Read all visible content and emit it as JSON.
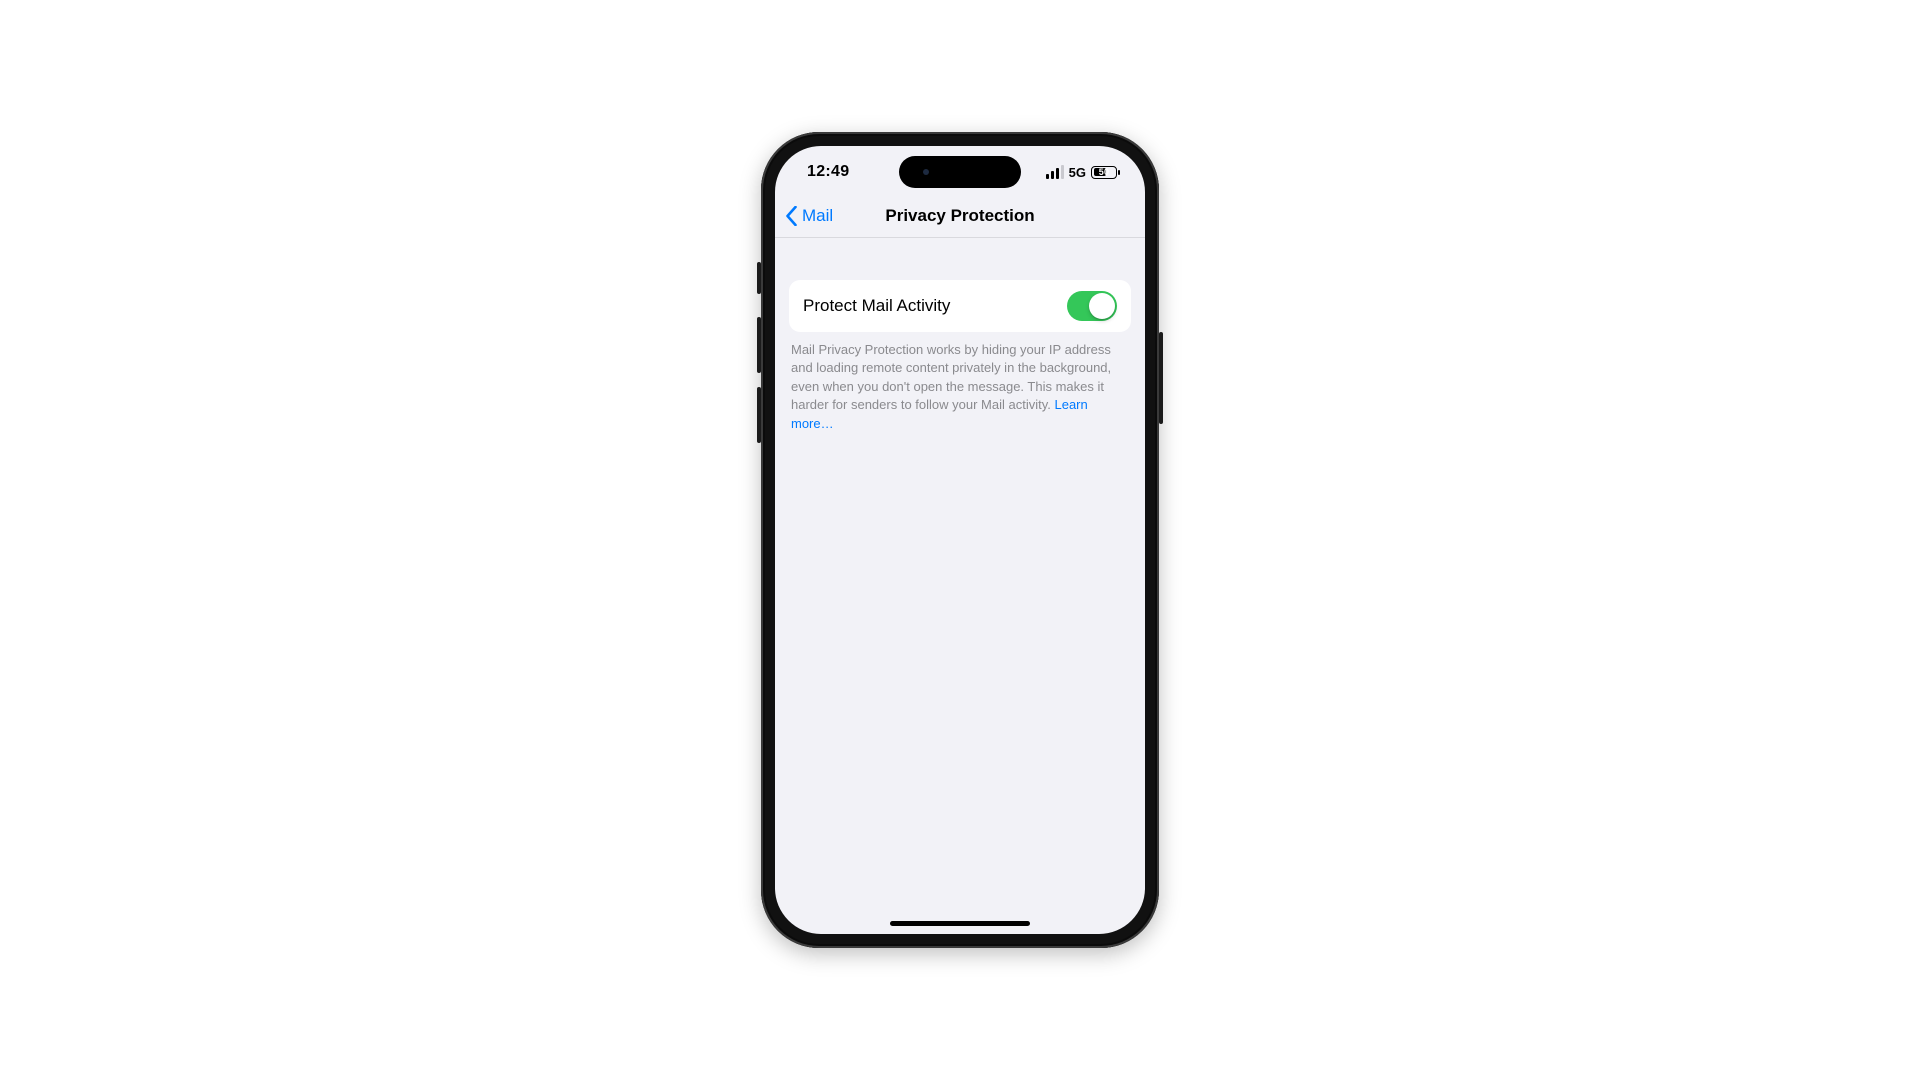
{
  "status": {
    "time": "12:49",
    "network": "5G",
    "battery_pct": "50"
  },
  "nav": {
    "back_label": "Mail",
    "title": "Privacy Protection"
  },
  "settings": {
    "protect_label": "Protect Mail Activity",
    "protect_on": true
  },
  "footnote": {
    "text": "Mail Privacy Protection works by hiding your IP address and loading remote content privately in the background, even when you don't open the message. This makes it harder for senders to follow your Mail activity. ",
    "learn_more": "Learn more…"
  },
  "colors": {
    "ios_blue": "#007aff",
    "ios_green": "#34c759",
    "settings_bg": "#f2f2f7"
  }
}
